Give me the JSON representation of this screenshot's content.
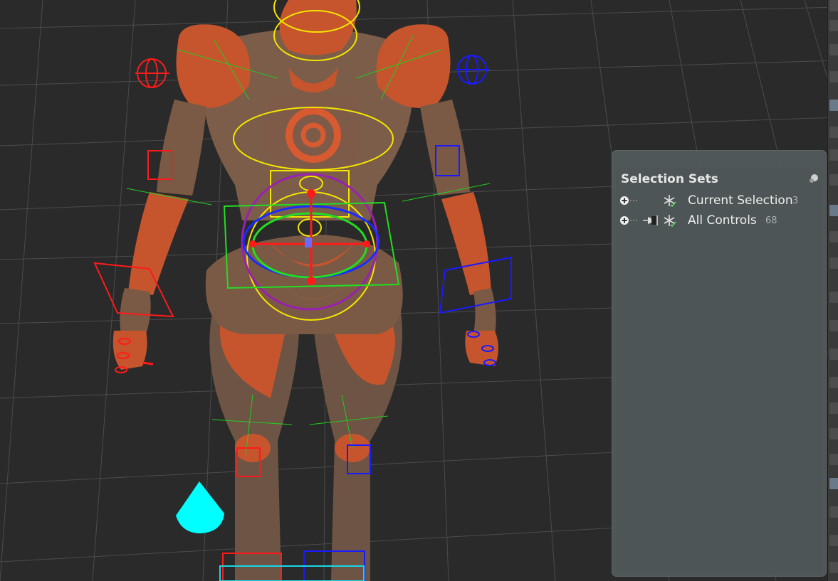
{
  "panel": {
    "title": "Selection Sets",
    "rows": [
      {
        "name": "Current Selection",
        "count": "3"
      },
      {
        "name": "All Controls",
        "count": "68"
      }
    ]
  },
  "colors": {
    "viewport_bg": "#2a2a2a",
    "grid": "#555555",
    "character_orange": "#c8552c",
    "character_wood": "#7a5a45",
    "control_left": "#ff1a1a",
    "control_right": "#1a1aff",
    "control_center": "#ffee00",
    "control_green": "#22dd22",
    "cone_cyan": "#00ffff",
    "panel_bg": "#535a5c"
  }
}
